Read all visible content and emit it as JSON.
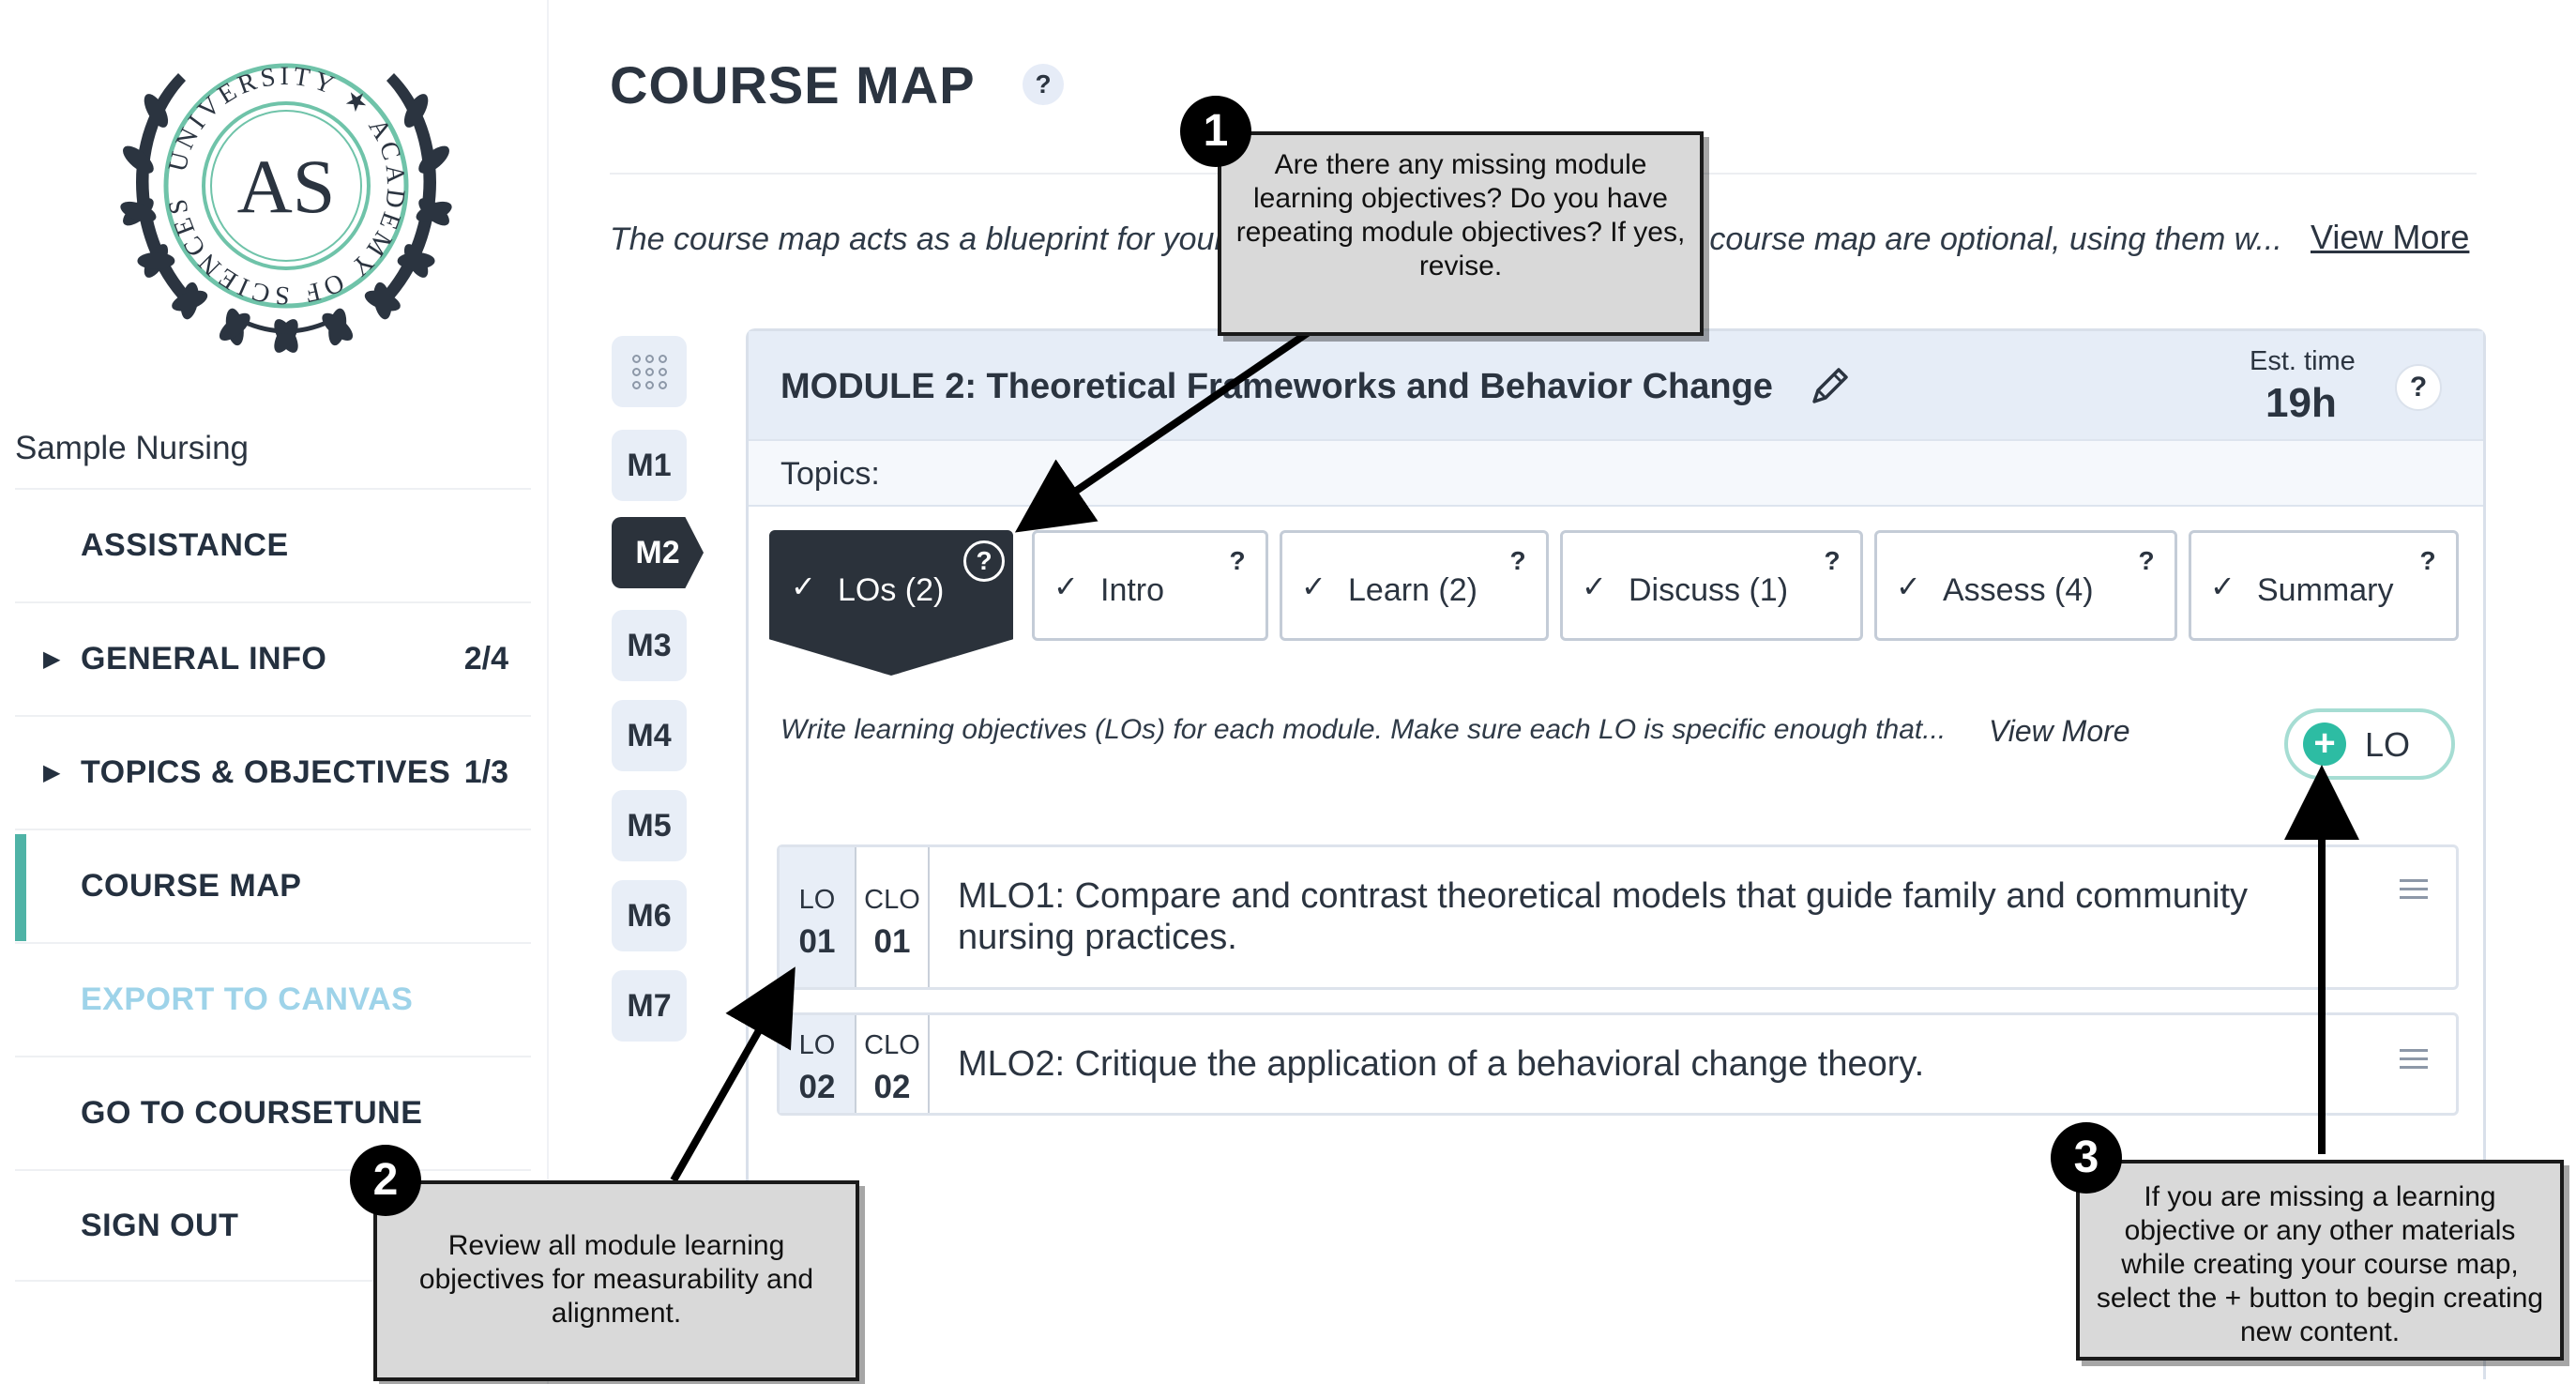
{
  "sidebar": {
    "logo": {
      "ring_text": "UNIVERSITY ★ ACADEMY OF SCIENCES ★",
      "monogram": "AS",
      "ring_color": "#6fc3a9",
      "laurel_color": "#2b3440"
    },
    "school_name": "Sample Nursing",
    "nav": [
      {
        "label": "ASSISTANCE",
        "count": "",
        "caret": ""
      },
      {
        "label": "GENERAL INFO",
        "count": "2/4",
        "caret": "▶"
      },
      {
        "label": "TOPICS & OBJECTIVES",
        "count": "1/3",
        "caret": "▶"
      },
      {
        "label": "COURSE MAP",
        "count": "",
        "caret": "",
        "active": true
      },
      {
        "label": "EXPORT TO CANVAS",
        "count": "",
        "caret": "",
        "disabled": true
      },
      {
        "label": "GO TO COURSETUNE",
        "count": "",
        "caret": ""
      },
      {
        "label": "SIGN OUT",
        "count": "",
        "caret": ""
      }
    ],
    "active_accent": "#4fb3a6"
  },
  "header": {
    "title": "COURSE MAP",
    "help_glyph": "?",
    "intro": "The course map acts as a blueprint for your course. Additional sections of the course map are optional, using them w...",
    "view_more": "View More"
  },
  "rail": {
    "grid_icon": "grid-icon",
    "modules": [
      "M1",
      "M2",
      "M3",
      "M4",
      "M5",
      "M6",
      "M7"
    ],
    "active": "M2"
  },
  "module": {
    "title": "MODULE 2:   Theoretical Frameworks and Behavior Change",
    "edit_icon": "pencil-icon",
    "est_label": "Est. time",
    "est_value": "19h",
    "help_glyph": "?",
    "topics_label": "Topics:",
    "tabs": [
      {
        "label": "LOs (2)",
        "active": true
      },
      {
        "label": "Intro"
      },
      {
        "label": "Learn (2)"
      },
      {
        "label": "Discuss (1)"
      },
      {
        "label": "Assess (4)"
      },
      {
        "label": "Summary"
      }
    ],
    "check_glyph": "✓",
    "lo_description": "Write learning objectives (LOs) for each module. Make sure each LO is specific enough that...",
    "lo_view_more": "View More",
    "add_button": {
      "plus": "+",
      "label": "LO",
      "accent": "#2dbca3"
    },
    "objectives": [
      {
        "lo_label": "LO",
        "lo_num": "01",
        "clo_label": "CLO",
        "clo_num": "01",
        "text_line1": "MLO1: Compare and contrast theoretical models that guide family and community",
        "text_line2": "nursing practices."
      },
      {
        "lo_label": "LO",
        "lo_num": "02",
        "clo_label": "CLO",
        "clo_num": "02",
        "text_line1": "MLO2: Critique the application of a behavioral change theory.",
        "text_line2": ""
      }
    ]
  },
  "annotations": [
    {
      "number": "1",
      "text": "Are there any missing module learning objectives? Do you have repeating module objectives? If yes, revise."
    },
    {
      "number": "2",
      "text": "Review all module learning objectives for measurability and alignment."
    },
    {
      "number": "3",
      "text": "If you are missing a learning objective or any other materials while creating your course map, select the + button to begin creating new content."
    }
  ]
}
